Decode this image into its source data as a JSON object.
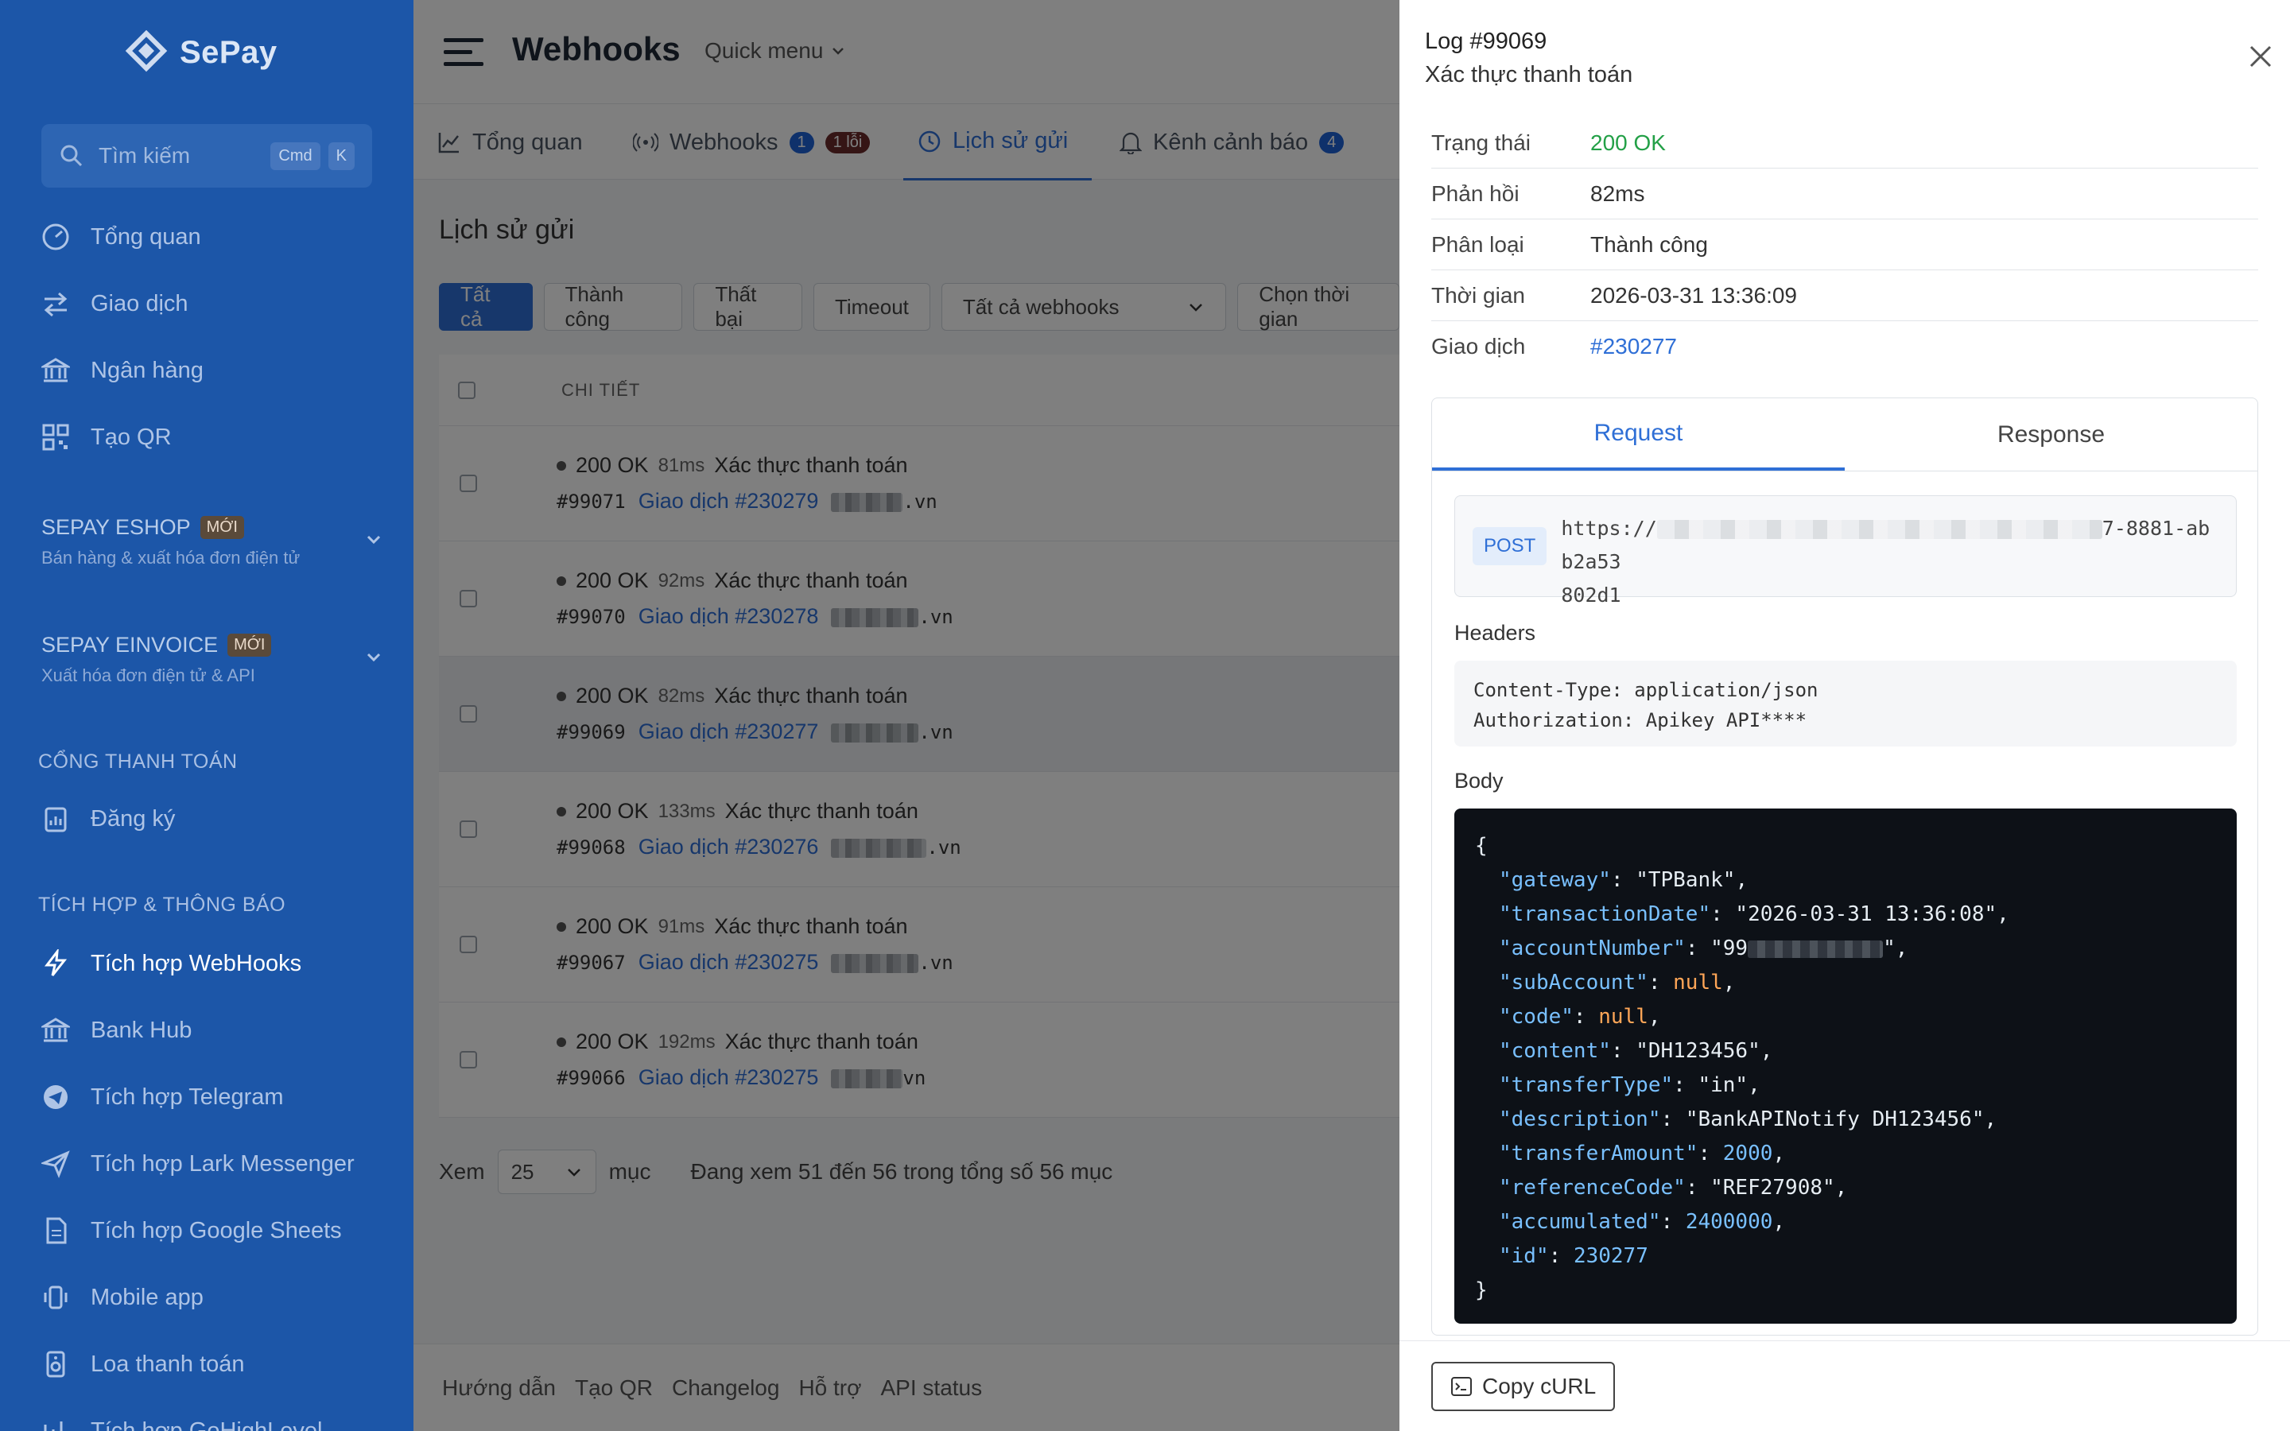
{
  "sidebar": {
    "logo": "SePay",
    "search_placeholder": "Tìm kiếm",
    "kbd1": "Cmd",
    "kbd2": "K",
    "items": [
      {
        "label": "Tổng quan"
      },
      {
        "label": "Giao dịch"
      },
      {
        "label": "Ngân hàng"
      },
      {
        "label": "Tạo QR"
      }
    ],
    "eshop": {
      "title": "SEPAY ESHOP",
      "badge": "MỚI",
      "sub": "Bán hàng & xuất hóa đơn điện tử"
    },
    "einvoice": {
      "title": "SEPAY EINVOICE",
      "badge": "MỚI",
      "sub": "Xuất hóa đơn điện tử & API"
    },
    "section_payment": "CỔNG THANH TOÁN",
    "register": "Đăng ký",
    "section_integration": "TÍCH HỢP & THÔNG BÁO",
    "integrations": [
      {
        "label": "Tích hợp WebHooks"
      },
      {
        "label": "Bank Hub"
      },
      {
        "label": "Tích hợp Telegram"
      },
      {
        "label": "Tích hợp Lark Messenger"
      },
      {
        "label": "Tích hợp Google Sheets"
      },
      {
        "label": "Mobile app"
      },
      {
        "label": "Loa thanh toán"
      },
      {
        "label": "Tích hợp GoHighLevel"
      }
    ]
  },
  "main": {
    "title": "Webhooks",
    "quick_menu": "Quick menu",
    "tabs": [
      {
        "label": "Tổng quan"
      },
      {
        "label": "Webhooks",
        "count": "1",
        "errors": "1 lỗi"
      },
      {
        "label": "Lịch sử gửi"
      },
      {
        "label": "Kênh cảnh báo",
        "count": "4"
      }
    ],
    "section": "Lịch sử gửi",
    "filters": {
      "all": "Tất cả",
      "success": "Thành công",
      "failed": "Thất bại",
      "timeout": "Timeout",
      "select": "Tất cả webhooks",
      "date": "Chọn thời gian"
    },
    "table_header": "CHI TIẾT",
    "rows": [
      {
        "status": "200 OK",
        "ms": "81ms",
        "event": "Xác thực thanh toán",
        "id": "#99071",
        "tx": "Giao dịch #230279",
        "dom": ".vn"
      },
      {
        "status": "200 OK",
        "ms": "92ms",
        "event": "Xác thực thanh toán",
        "id": "#99070",
        "tx": "Giao dịch #230278",
        "dom": ".vn"
      },
      {
        "status": "200 OK",
        "ms": "82ms",
        "event": "Xác thực thanh toán",
        "id": "#99069",
        "tx": "Giao dịch #230277",
        "dom": ".vn"
      },
      {
        "status": "200 OK",
        "ms": "133ms",
        "event": "Xác thực thanh toán",
        "id": "#99068",
        "tx": "Giao dịch #230276",
        "dom": ".vn"
      },
      {
        "status": "200 OK",
        "ms": "91ms",
        "event": "Xác thực thanh toán",
        "id": "#99067",
        "tx": "Giao dịch #230275",
        "dom": ".vn"
      },
      {
        "status": "200 OK",
        "ms": "192ms",
        "event": "Xác thực thanh toán",
        "id": "#99066",
        "tx": "Giao dịch #230275",
        "dom": "vn"
      }
    ],
    "pager": {
      "view": "Xem",
      "per_page": "25",
      "unit": "mục",
      "summary": "Đang xem 51 đến 56 trong tổng số 56 mục"
    },
    "footer": [
      "Hướng dẫn",
      "Tạo QR",
      "Changelog",
      "Hỗ trợ",
      "API status"
    ]
  },
  "drawer": {
    "title": "Log #99069",
    "subtitle": "Xác thực thanh toán",
    "fields": [
      {
        "k": "Trạng thái",
        "v": "200 OK"
      },
      {
        "k": "Phản hồi",
        "v": "82ms"
      },
      {
        "k": "Phân loại",
        "v": "Thành công"
      },
      {
        "k": "Thời gian",
        "v": "2026-03-31 13:36:09"
      },
      {
        "k": "Giao dịch",
        "v": "#230277"
      }
    ],
    "tab_request": "Request",
    "tab_response": "Response",
    "method": "POST",
    "url_start": "https://",
    "url_end": "7-8881-abb2a53",
    "url_end2": "802d1",
    "headers_label": "Headers",
    "headers": [
      "Content-Type: application/json",
      "Authorization: Apikey API****"
    ],
    "body_label": "Body",
    "body": {
      "gateway": "\"TPBank\"",
      "transactionDate": "\"2026-03-31 13:36:08\"",
      "accountNumber": "\"99",
      "subAccount": "null",
      "code": "null",
      "content": "\"DH123456\"",
      "transferType": "\"in\"",
      "description": "\"BankAPINotify DH123456\"",
      "transferAmount": "2000",
      "referenceCode": "\"REF27908\"",
      "accumulated": "2400000",
      "id": "230277"
    },
    "copy": "Copy cURL"
  },
  "colors": {
    "sidebar": "#1c56a8",
    "accent": "#2f6fd6",
    "ok": "#23a047",
    "code_bg": "#0d1117"
  }
}
